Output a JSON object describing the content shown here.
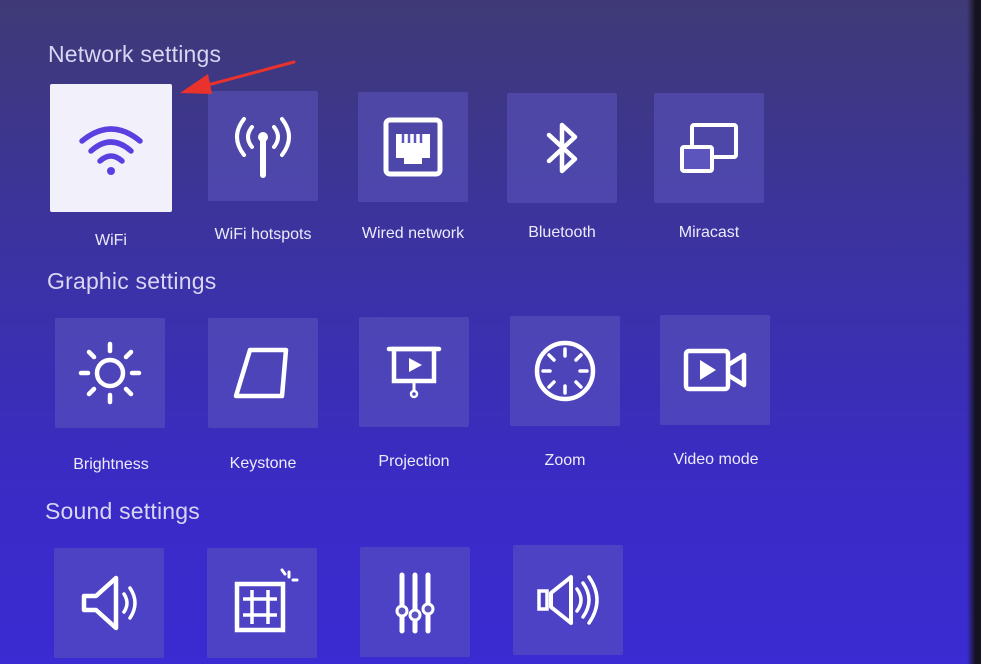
{
  "sections": {
    "network": {
      "title": "Network settings",
      "items": [
        {
          "label": "WiFi",
          "icon": "wifi-icon",
          "selected": true
        },
        {
          "label": "WiFi hotspots",
          "icon": "hotspot-icon"
        },
        {
          "label": "Wired network",
          "icon": "ethernet-icon"
        },
        {
          "label": "Bluetooth",
          "icon": "bluetooth-icon"
        },
        {
          "label": "Miracast",
          "icon": "miracast-icon"
        }
      ]
    },
    "graphic": {
      "title": "Graphic settings",
      "items": [
        {
          "label": "Brightness",
          "icon": "brightness-icon"
        },
        {
          "label": "Keystone",
          "icon": "keystone-icon"
        },
        {
          "label": "Projection",
          "icon": "projection-icon"
        },
        {
          "label": "Zoom",
          "icon": "zoom-icon"
        },
        {
          "label": "Video mode",
          "icon": "video-mode-icon"
        }
      ]
    },
    "sound": {
      "title": "Sound settings",
      "items": [
        {
          "icon": "speaker-icon"
        },
        {
          "icon": "grid-sparkle-icon"
        },
        {
          "icon": "equalizer-icon"
        },
        {
          "icon": "sound-mode-icon"
        }
      ]
    }
  },
  "colors": {
    "accent": "#5b3fe0",
    "tile": "#5c55be",
    "annotation_arrow": "#e8322b"
  }
}
